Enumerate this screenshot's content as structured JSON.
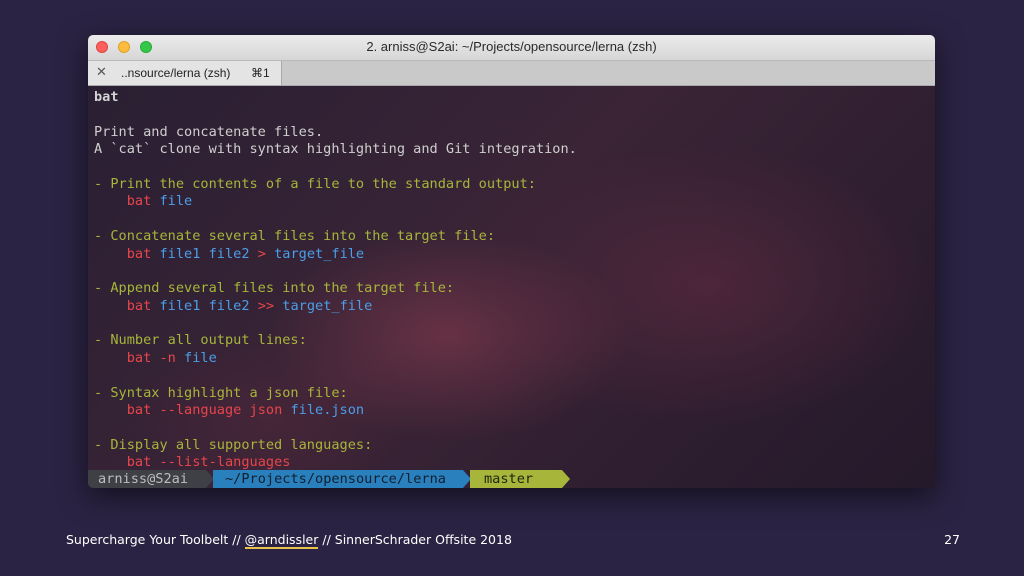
{
  "window": {
    "title": "2. arniss@S2ai: ~/Projects/opensource/lerna (zsh)",
    "tab": {
      "close_glyph": "✕",
      "label": "..nsource/lerna (zsh)",
      "shortcut": "⌘1"
    }
  },
  "terminal": {
    "heading": "bat",
    "desc1": "Print and concatenate files.",
    "desc2": "A `cat` clone with syntax highlighting and Git integration.",
    "examples": [
      {
        "desc": "- Print the contents of a file to the standard output:",
        "cmd": "bat",
        "args": [
          {
            "t": " file",
            "c": "blue"
          }
        ]
      },
      {
        "desc": "- Concatenate several files into the target file:",
        "cmd": "bat",
        "args": [
          {
            "t": " file1 file2 ",
            "c": "blue"
          },
          {
            "t": ">",
            "c": "red"
          },
          {
            "t": " target_file",
            "c": "blue"
          }
        ]
      },
      {
        "desc": "- Append several files into the target file:",
        "cmd": "bat",
        "args": [
          {
            "t": " file1 file2 ",
            "c": "blue"
          },
          {
            "t": ">>",
            "c": "red"
          },
          {
            "t": " target_file",
            "c": "blue"
          }
        ]
      },
      {
        "desc": "- Number all output lines:",
        "cmd": "bat",
        "args": [
          {
            "t": " -n",
            "c": "red"
          },
          {
            "t": " file",
            "c": "blue"
          }
        ]
      },
      {
        "desc": "- Syntax highlight a json file:",
        "cmd": "bat",
        "args": [
          {
            "t": " --language json",
            "c": "red"
          },
          {
            "t": " file",
            "c": "blue"
          },
          {
            "t": ".json",
            "c": "blue"
          }
        ]
      },
      {
        "desc": "- Display all supported languages:",
        "cmd": "bat",
        "args": [
          {
            "t": " --list-languages",
            "c": "red"
          }
        ]
      }
    ]
  },
  "prompt": {
    "user": "arniss@S2ai",
    "path": "~/Projects/opensource/lerna",
    "branch_icon": "",
    "branch": "master"
  },
  "footer": {
    "left_prefix": "Supercharge Your Toolbelt // ",
    "handle": "@arndissler",
    "left_suffix": " // SinnerSchrader Offsite 2018",
    "page_number": "27"
  },
  "colors": {
    "green": "#a7b53a",
    "red": "#e8454b",
    "blue": "#4a9ee8",
    "background": "#2b2343"
  }
}
